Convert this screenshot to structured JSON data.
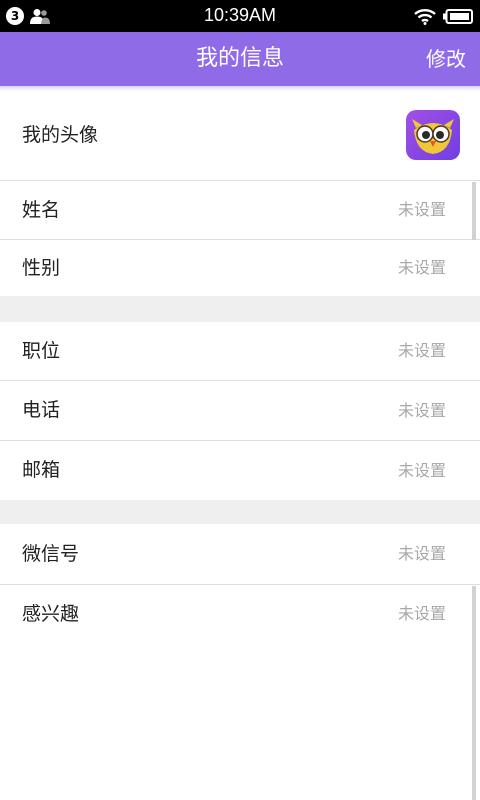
{
  "status_bar": {
    "notification_count": "3",
    "time": "10:39AM",
    "icons": [
      "notification-count-icon",
      "contacts-icon",
      "wifi-icon",
      "battery-icon"
    ]
  },
  "header": {
    "title": "我的信息",
    "edit_label": "修改",
    "color": "#8f6be8"
  },
  "profile": {
    "avatar_label": "我的头像",
    "avatar_icon": "owl-app-icon",
    "fields": [
      {
        "label": "姓名",
        "value": "未设置"
      },
      {
        "label": "性别",
        "value": "未设置"
      },
      {
        "label": "职位",
        "value": "未设置"
      },
      {
        "label": "电话",
        "value": "未设置"
      },
      {
        "label": "邮箱",
        "value": "未设置"
      },
      {
        "label": "微信号",
        "value": "未设置"
      },
      {
        "label": "感兴趣",
        "value": "未设置"
      }
    ]
  }
}
